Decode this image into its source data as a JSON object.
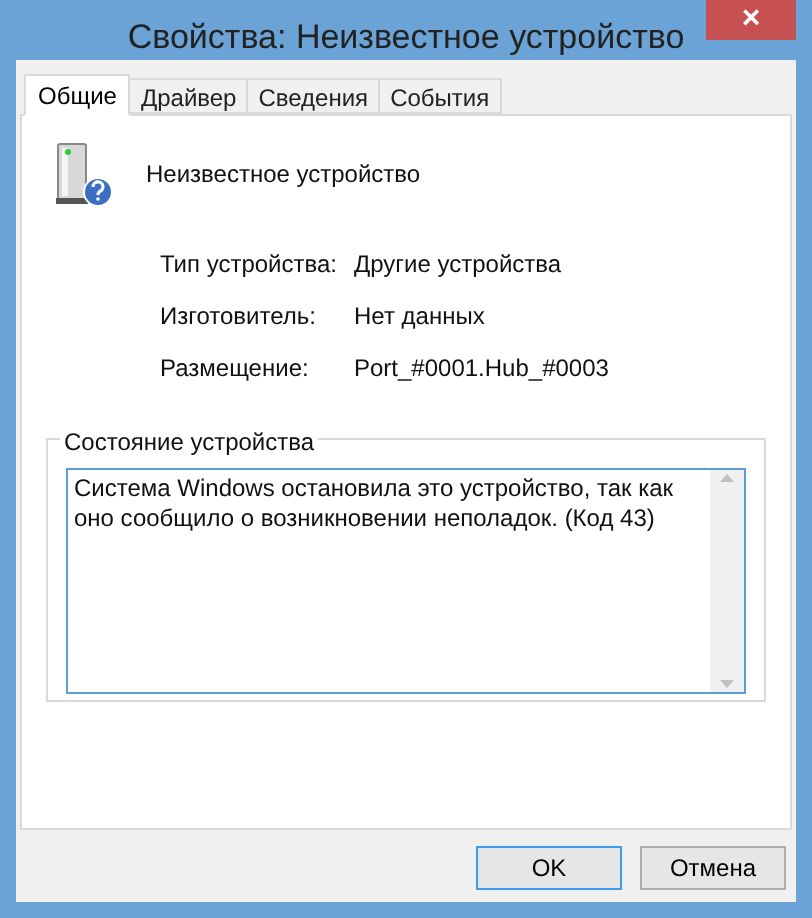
{
  "window": {
    "title": "Свойства: Неизвестное устройство",
    "close": "×"
  },
  "tabs": [
    {
      "label": "Общие",
      "selected": true
    },
    {
      "label": "Драйвер",
      "selected": false
    },
    {
      "label": "Сведения",
      "selected": false
    },
    {
      "label": "События",
      "selected": false
    }
  ],
  "device": {
    "name": "Неизвестное устройство"
  },
  "properties": [
    {
      "label": "Тип устройства:",
      "value": "Другие устройства"
    },
    {
      "label": "Изготовитель:",
      "value": "Нет данных"
    },
    {
      "label": "Размещение:",
      "value": "Port_#0001.Hub_#0003"
    }
  ],
  "status": {
    "legend": "Состояние устройства",
    "text": "Система Windows остановила это устройство, так как оно сообщило о возникновении неполадок. (Код 43)"
  },
  "buttons": [
    {
      "label": "OK",
      "default": true
    },
    {
      "label": "Отмена",
      "default": false
    }
  ]
}
